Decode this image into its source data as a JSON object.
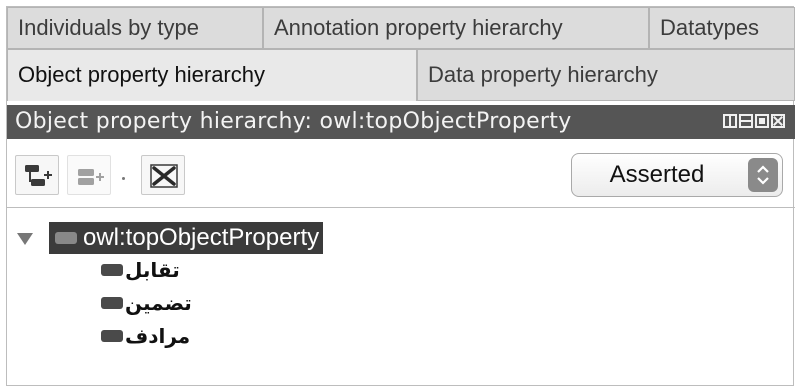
{
  "tabs_row1": [
    {
      "label": "Individuals by type"
    },
    {
      "label": "Annotation property hierarchy"
    },
    {
      "label": "Datatypes"
    }
  ],
  "tabs_row2": [
    {
      "label": "Object property hierarchy",
      "active": true
    },
    {
      "label": "Data property hierarchy"
    }
  ],
  "view": {
    "title": "Object property hierarchy: owl:topObjectProperty"
  },
  "toolbar": {
    "add_sub_property_icon": "add-subproperty-icon",
    "add_sibling_property_icon": "add-sibling-property-icon",
    "delete_property_icon": "delete-property-icon"
  },
  "mode_select": {
    "value": "Asserted"
  },
  "tree": {
    "root": {
      "label": "owl:topObjectProperty",
      "expanded": true
    },
    "children": [
      {
        "label": "تقابل"
      },
      {
        "label": "تضمين"
      },
      {
        "label": "مرادف"
      }
    ]
  },
  "colors": {
    "title_bar_bg": "#555555",
    "selected_row_bg": "#3b3b3b",
    "tab_bg": "#dcdcdc"
  }
}
